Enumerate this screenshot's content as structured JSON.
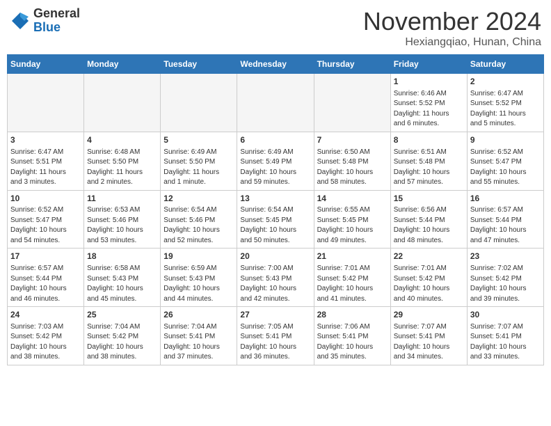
{
  "header": {
    "logo_general": "General",
    "logo_blue": "Blue",
    "month_title": "November 2024",
    "subtitle": "Hexiangqiao, Hunan, China"
  },
  "weekdays": [
    "Sunday",
    "Monday",
    "Tuesday",
    "Wednesday",
    "Thursday",
    "Friday",
    "Saturday"
  ],
  "weeks": [
    [
      {
        "day": "",
        "info": ""
      },
      {
        "day": "",
        "info": ""
      },
      {
        "day": "",
        "info": ""
      },
      {
        "day": "",
        "info": ""
      },
      {
        "day": "",
        "info": ""
      },
      {
        "day": "1",
        "info": "Sunrise: 6:46 AM\nSunset: 5:52 PM\nDaylight: 11 hours\nand 6 minutes."
      },
      {
        "day": "2",
        "info": "Sunrise: 6:47 AM\nSunset: 5:52 PM\nDaylight: 11 hours\nand 5 minutes."
      }
    ],
    [
      {
        "day": "3",
        "info": "Sunrise: 6:47 AM\nSunset: 5:51 PM\nDaylight: 11 hours\nand 3 minutes."
      },
      {
        "day": "4",
        "info": "Sunrise: 6:48 AM\nSunset: 5:50 PM\nDaylight: 11 hours\nand 2 minutes."
      },
      {
        "day": "5",
        "info": "Sunrise: 6:49 AM\nSunset: 5:50 PM\nDaylight: 11 hours\nand 1 minute."
      },
      {
        "day": "6",
        "info": "Sunrise: 6:49 AM\nSunset: 5:49 PM\nDaylight: 10 hours\nand 59 minutes."
      },
      {
        "day": "7",
        "info": "Sunrise: 6:50 AM\nSunset: 5:48 PM\nDaylight: 10 hours\nand 58 minutes."
      },
      {
        "day": "8",
        "info": "Sunrise: 6:51 AM\nSunset: 5:48 PM\nDaylight: 10 hours\nand 57 minutes."
      },
      {
        "day": "9",
        "info": "Sunrise: 6:52 AM\nSunset: 5:47 PM\nDaylight: 10 hours\nand 55 minutes."
      }
    ],
    [
      {
        "day": "10",
        "info": "Sunrise: 6:52 AM\nSunset: 5:47 PM\nDaylight: 10 hours\nand 54 minutes."
      },
      {
        "day": "11",
        "info": "Sunrise: 6:53 AM\nSunset: 5:46 PM\nDaylight: 10 hours\nand 53 minutes."
      },
      {
        "day": "12",
        "info": "Sunrise: 6:54 AM\nSunset: 5:46 PM\nDaylight: 10 hours\nand 52 minutes."
      },
      {
        "day": "13",
        "info": "Sunrise: 6:54 AM\nSunset: 5:45 PM\nDaylight: 10 hours\nand 50 minutes."
      },
      {
        "day": "14",
        "info": "Sunrise: 6:55 AM\nSunset: 5:45 PM\nDaylight: 10 hours\nand 49 minutes."
      },
      {
        "day": "15",
        "info": "Sunrise: 6:56 AM\nSunset: 5:44 PM\nDaylight: 10 hours\nand 48 minutes."
      },
      {
        "day": "16",
        "info": "Sunrise: 6:57 AM\nSunset: 5:44 PM\nDaylight: 10 hours\nand 47 minutes."
      }
    ],
    [
      {
        "day": "17",
        "info": "Sunrise: 6:57 AM\nSunset: 5:44 PM\nDaylight: 10 hours\nand 46 minutes."
      },
      {
        "day": "18",
        "info": "Sunrise: 6:58 AM\nSunset: 5:43 PM\nDaylight: 10 hours\nand 45 minutes."
      },
      {
        "day": "19",
        "info": "Sunrise: 6:59 AM\nSunset: 5:43 PM\nDaylight: 10 hours\nand 44 minutes."
      },
      {
        "day": "20",
        "info": "Sunrise: 7:00 AM\nSunset: 5:43 PM\nDaylight: 10 hours\nand 42 minutes."
      },
      {
        "day": "21",
        "info": "Sunrise: 7:01 AM\nSunset: 5:42 PM\nDaylight: 10 hours\nand 41 minutes."
      },
      {
        "day": "22",
        "info": "Sunrise: 7:01 AM\nSunset: 5:42 PM\nDaylight: 10 hours\nand 40 minutes."
      },
      {
        "day": "23",
        "info": "Sunrise: 7:02 AM\nSunset: 5:42 PM\nDaylight: 10 hours\nand 39 minutes."
      }
    ],
    [
      {
        "day": "24",
        "info": "Sunrise: 7:03 AM\nSunset: 5:42 PM\nDaylight: 10 hours\nand 38 minutes."
      },
      {
        "day": "25",
        "info": "Sunrise: 7:04 AM\nSunset: 5:42 PM\nDaylight: 10 hours\nand 38 minutes."
      },
      {
        "day": "26",
        "info": "Sunrise: 7:04 AM\nSunset: 5:41 PM\nDaylight: 10 hours\nand 37 minutes."
      },
      {
        "day": "27",
        "info": "Sunrise: 7:05 AM\nSunset: 5:41 PM\nDaylight: 10 hours\nand 36 minutes."
      },
      {
        "day": "28",
        "info": "Sunrise: 7:06 AM\nSunset: 5:41 PM\nDaylight: 10 hours\nand 35 minutes."
      },
      {
        "day": "29",
        "info": "Sunrise: 7:07 AM\nSunset: 5:41 PM\nDaylight: 10 hours\nand 34 minutes."
      },
      {
        "day": "30",
        "info": "Sunrise: 7:07 AM\nSunset: 5:41 PM\nDaylight: 10 hours\nand 33 minutes."
      }
    ]
  ]
}
